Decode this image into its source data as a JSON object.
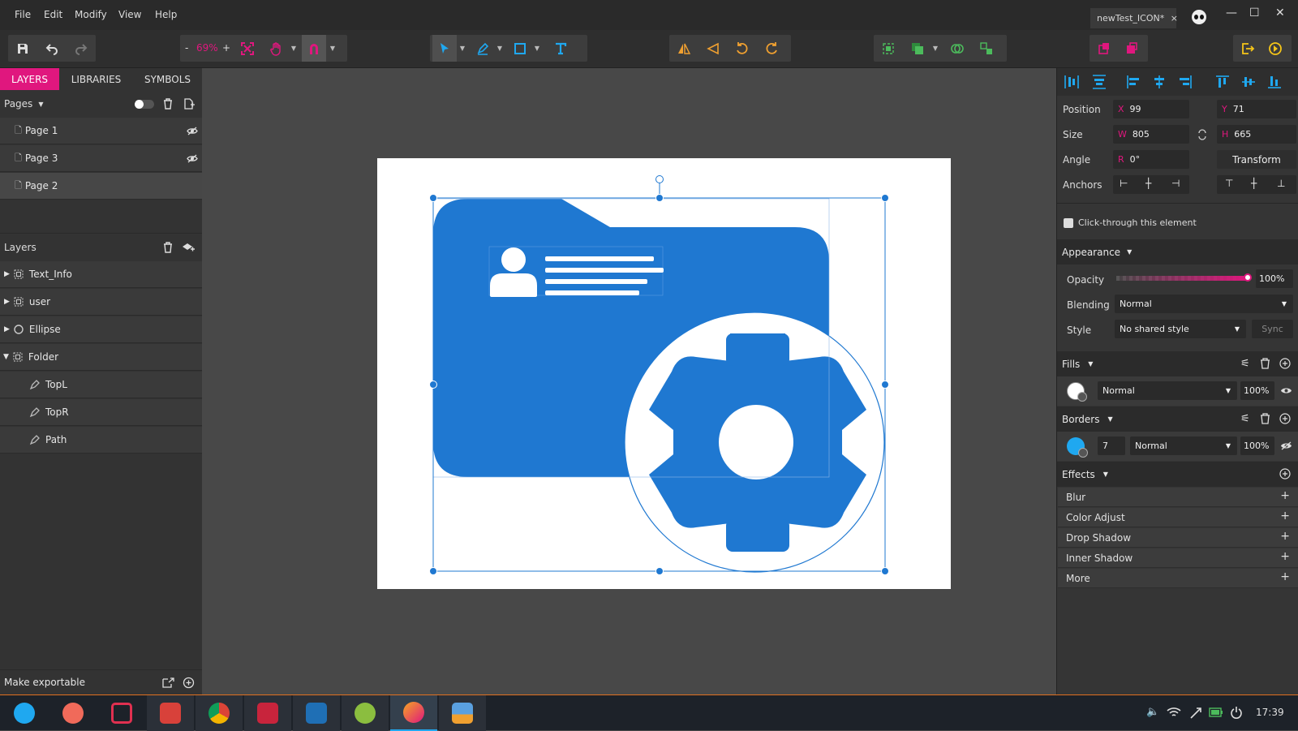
{
  "menu": [
    "File",
    "Edit",
    "Modify",
    "View",
    "Help"
  ],
  "document_tab": {
    "title": "newTest_ICON*",
    "close": "×"
  },
  "window_controls": {
    "minimize": "—",
    "maximize": "☐",
    "close": "✕"
  },
  "toolbar": {
    "zoom_minus": "-",
    "zoom_value": "69%",
    "zoom_plus": "+"
  },
  "left_panel": {
    "tabs": [
      "LAYERS",
      "LIBRARIES",
      "SYMBOLS"
    ],
    "pages_label": "Pages",
    "pages": [
      {
        "name": "Page 1",
        "hidden": true
      },
      {
        "name": "Page 3",
        "hidden": true
      },
      {
        "name": "Page 2",
        "hidden": false,
        "selected": true
      }
    ],
    "layers_label": "Layers",
    "layers": [
      {
        "name": "Text_Info",
        "type": "group",
        "depth": 0,
        "expanded": false
      },
      {
        "name": "user",
        "type": "group",
        "depth": 0,
        "expanded": false
      },
      {
        "name": "Ellipse",
        "type": "ellipse",
        "depth": 0,
        "expanded": false
      },
      {
        "name": "Folder",
        "type": "group",
        "depth": 0,
        "expanded": true
      },
      {
        "name": "TopL",
        "type": "path",
        "depth": 1
      },
      {
        "name": "TopR",
        "type": "path",
        "depth": 1
      },
      {
        "name": "Path",
        "type": "path",
        "depth": 1
      }
    ],
    "make_exportable": "Make exportable"
  },
  "right_panel": {
    "position_label": "Position",
    "x_label": "X",
    "x": "99",
    "y_label": "Y",
    "y": "71",
    "size_label": "Size",
    "w_label": "W",
    "w": "805",
    "h_label": "H",
    "h": "665",
    "angle_label": "Angle",
    "r_label": "R",
    "r": "0°",
    "transform_button": "Transform",
    "anchors_label": "Anchors",
    "click_through": "Click-through this element",
    "appearance_label": "Appearance",
    "opacity_label": "Opacity",
    "opacity_value": "100%",
    "opacity_level": 1.0,
    "blending_label": "Blending",
    "blending_value": "Normal",
    "style_label": "Style",
    "style_value": "No shared style",
    "sync_button": "Sync",
    "fills_label": "Fills",
    "fill_blend": "Normal",
    "fill_opacity": "100%",
    "fill_color": "#ffffff",
    "borders_label": "Borders",
    "border_width": "7",
    "border_blend": "Normal",
    "border_opacity": "100%",
    "border_color": "#1fa8f0",
    "effects_label": "Effects",
    "effects": [
      "Blur",
      "Color Adjust",
      "Drop Shadow",
      "Inner Shadow",
      "More"
    ]
  },
  "colors": {
    "accent": "#e0177e",
    "shape_blue": "#1f78d1",
    "selection": "#1f78d1"
  },
  "taskbar": {
    "apps": [
      "app-menu-icon",
      "screen-recorder-icon",
      "crop-tool-icon",
      "pdf-reader-icon",
      "chrome-icon",
      "terminal-icon",
      "vscode-icon",
      "qgis-icon",
      "design-app-icon",
      "image-viewer-icon"
    ],
    "clock": "17:39"
  }
}
